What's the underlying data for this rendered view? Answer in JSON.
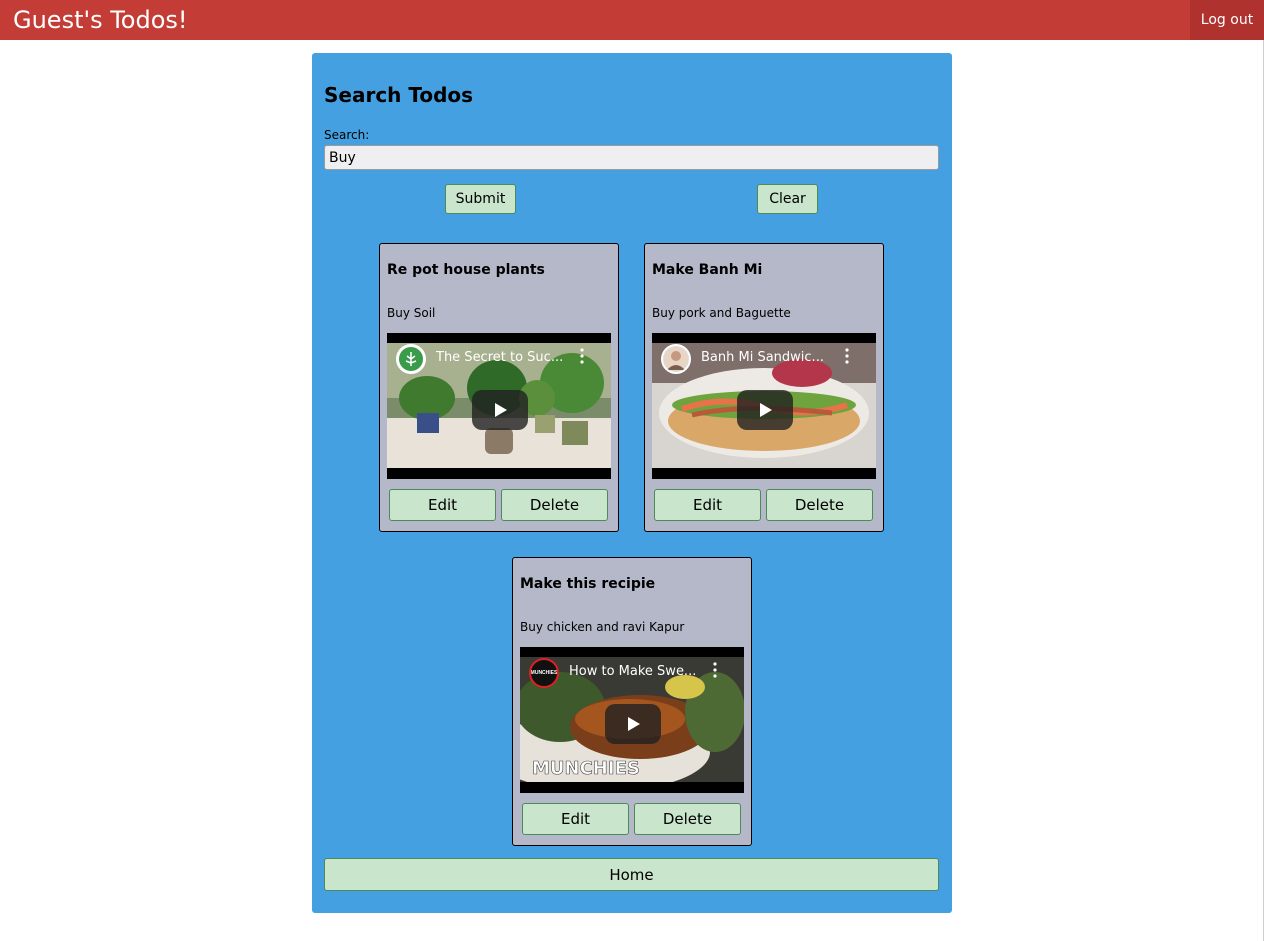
{
  "header": {
    "title": "Guest's Todos!",
    "logout_label": "Log out",
    "bg_color": "#c43c36"
  },
  "search": {
    "heading": "Search Todos",
    "label": "Search:",
    "value": "Buy",
    "submit_label": "Submit",
    "clear_label": "Clear"
  },
  "todos": [
    {
      "title": "Re pot house plants",
      "description": "Buy Soil",
      "video_title": "The Secret to Suc...",
      "edit_label": "Edit",
      "delete_label": "Delete"
    },
    {
      "title": "Make Banh Mi",
      "description": "Buy pork and Baguette",
      "video_title": "Banh Mi Sandwic...",
      "edit_label": "Edit",
      "delete_label": "Delete"
    },
    {
      "title": "Make this recipie",
      "description": "Buy chicken and ravi Kapur",
      "video_title": "How to Make Swe...",
      "channel_badge": "MUNCHIES",
      "watermark": "MUNCHIES",
      "edit_label": "Edit",
      "delete_label": "Delete"
    }
  ],
  "home_label": "Home",
  "colors": {
    "panel": "#44a0e0",
    "card": "#b4b8c8",
    "button": "#c9e6cd"
  }
}
